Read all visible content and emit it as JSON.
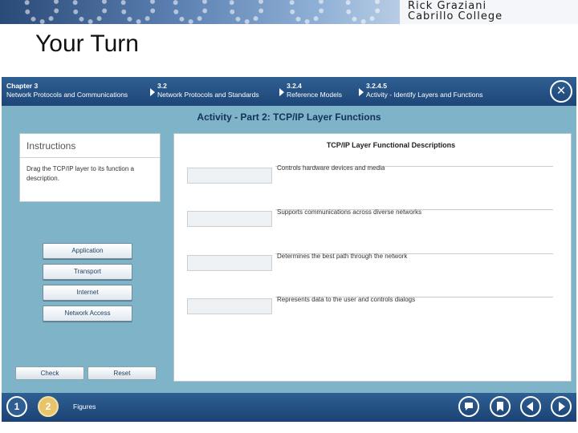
{
  "banner": {
    "author": "Rick Graziani",
    "college": "Cabrillo College"
  },
  "slide": {
    "title": "Your Turn"
  },
  "activity": {
    "breadcrumbs": [
      {
        "number": "Chapter 3",
        "label": "Network Protocols and Communications"
      },
      {
        "number": "3.2",
        "label": "Network Protocols and Standards"
      },
      {
        "number": "3.2.4",
        "label": "Reference Models"
      },
      {
        "number": "3.2.4.5",
        "label": "Activity - Identify Layers and Functions"
      }
    ],
    "close_icon": "×",
    "title": "Activity - Part 2: TCP/IP Layer Functions",
    "instructions": {
      "heading": "Instructions",
      "body": "Drag the TCP/IP layer to its function a description."
    },
    "layers": [
      "Application",
      "Transport",
      "Internet",
      "Network Access"
    ],
    "buttons": {
      "check": "Check",
      "reset": "Reset"
    },
    "panel": {
      "title": "TCP/IP Layer Functional Descriptions",
      "descriptions": [
        "Controls hardware devices and media",
        "Supports communications across diverse networks",
        "Determines the best path through the network",
        "Represents data to the user and controls dialogs"
      ]
    },
    "footer": {
      "pages": [
        "1",
        "2"
      ],
      "current_page": "2",
      "figures_label": "Figures",
      "nav_icons": [
        "comment-icon",
        "bookmark-icon",
        "previous-icon",
        "next-icon"
      ]
    }
  },
  "colors": {
    "bar_blue": "#1d4677",
    "frame_teal": "#7fb3c8",
    "active_page": "#e8c46a"
  }
}
